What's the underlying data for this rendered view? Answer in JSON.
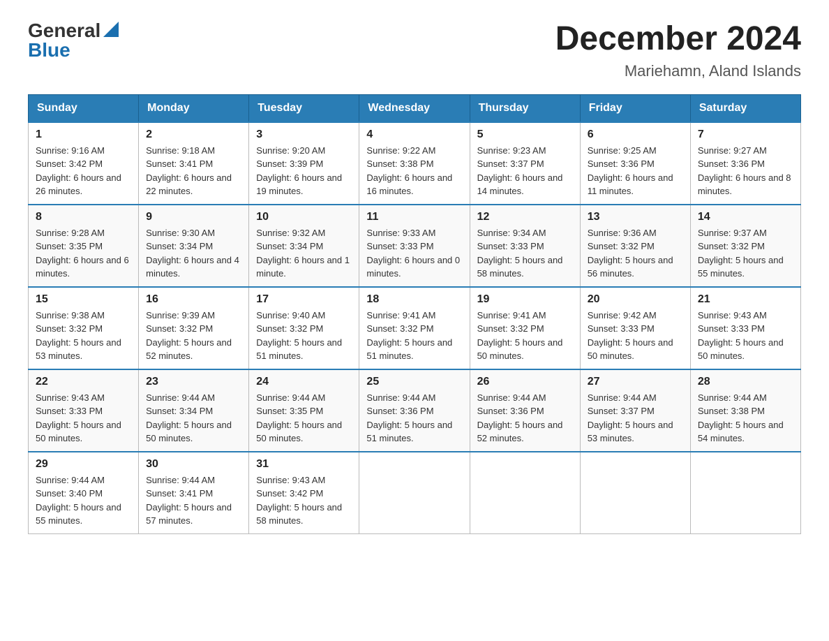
{
  "header": {
    "logo_general": "General",
    "logo_blue": "Blue",
    "title": "December 2024",
    "subtitle": "Mariehamn, Aland Islands"
  },
  "weekdays": [
    "Sunday",
    "Monday",
    "Tuesday",
    "Wednesday",
    "Thursday",
    "Friday",
    "Saturday"
  ],
  "weeks": [
    [
      {
        "day": "1",
        "sunrise": "9:16 AM",
        "sunset": "3:42 PM",
        "daylight": "6 hours and 26 minutes."
      },
      {
        "day": "2",
        "sunrise": "9:18 AM",
        "sunset": "3:41 PM",
        "daylight": "6 hours and 22 minutes."
      },
      {
        "day": "3",
        "sunrise": "9:20 AM",
        "sunset": "3:39 PM",
        "daylight": "6 hours and 19 minutes."
      },
      {
        "day": "4",
        "sunrise": "9:22 AM",
        "sunset": "3:38 PM",
        "daylight": "6 hours and 16 minutes."
      },
      {
        "day": "5",
        "sunrise": "9:23 AM",
        "sunset": "3:37 PM",
        "daylight": "6 hours and 14 minutes."
      },
      {
        "day": "6",
        "sunrise": "9:25 AM",
        "sunset": "3:36 PM",
        "daylight": "6 hours and 11 minutes."
      },
      {
        "day": "7",
        "sunrise": "9:27 AM",
        "sunset": "3:36 PM",
        "daylight": "6 hours and 8 minutes."
      }
    ],
    [
      {
        "day": "8",
        "sunrise": "9:28 AM",
        "sunset": "3:35 PM",
        "daylight": "6 hours and 6 minutes."
      },
      {
        "day": "9",
        "sunrise": "9:30 AM",
        "sunset": "3:34 PM",
        "daylight": "6 hours and 4 minutes."
      },
      {
        "day": "10",
        "sunrise": "9:32 AM",
        "sunset": "3:34 PM",
        "daylight": "6 hours and 1 minute."
      },
      {
        "day": "11",
        "sunrise": "9:33 AM",
        "sunset": "3:33 PM",
        "daylight": "6 hours and 0 minutes."
      },
      {
        "day": "12",
        "sunrise": "9:34 AM",
        "sunset": "3:33 PM",
        "daylight": "5 hours and 58 minutes."
      },
      {
        "day": "13",
        "sunrise": "9:36 AM",
        "sunset": "3:32 PM",
        "daylight": "5 hours and 56 minutes."
      },
      {
        "day": "14",
        "sunrise": "9:37 AM",
        "sunset": "3:32 PM",
        "daylight": "5 hours and 55 minutes."
      }
    ],
    [
      {
        "day": "15",
        "sunrise": "9:38 AM",
        "sunset": "3:32 PM",
        "daylight": "5 hours and 53 minutes."
      },
      {
        "day": "16",
        "sunrise": "9:39 AM",
        "sunset": "3:32 PM",
        "daylight": "5 hours and 52 minutes."
      },
      {
        "day": "17",
        "sunrise": "9:40 AM",
        "sunset": "3:32 PM",
        "daylight": "5 hours and 51 minutes."
      },
      {
        "day": "18",
        "sunrise": "9:41 AM",
        "sunset": "3:32 PM",
        "daylight": "5 hours and 51 minutes."
      },
      {
        "day": "19",
        "sunrise": "9:41 AM",
        "sunset": "3:32 PM",
        "daylight": "5 hours and 50 minutes."
      },
      {
        "day": "20",
        "sunrise": "9:42 AM",
        "sunset": "3:33 PM",
        "daylight": "5 hours and 50 minutes."
      },
      {
        "day": "21",
        "sunrise": "9:43 AM",
        "sunset": "3:33 PM",
        "daylight": "5 hours and 50 minutes."
      }
    ],
    [
      {
        "day": "22",
        "sunrise": "9:43 AM",
        "sunset": "3:33 PM",
        "daylight": "5 hours and 50 minutes."
      },
      {
        "day": "23",
        "sunrise": "9:44 AM",
        "sunset": "3:34 PM",
        "daylight": "5 hours and 50 minutes."
      },
      {
        "day": "24",
        "sunrise": "9:44 AM",
        "sunset": "3:35 PM",
        "daylight": "5 hours and 50 minutes."
      },
      {
        "day": "25",
        "sunrise": "9:44 AM",
        "sunset": "3:36 PM",
        "daylight": "5 hours and 51 minutes."
      },
      {
        "day": "26",
        "sunrise": "9:44 AM",
        "sunset": "3:36 PM",
        "daylight": "5 hours and 52 minutes."
      },
      {
        "day": "27",
        "sunrise": "9:44 AM",
        "sunset": "3:37 PM",
        "daylight": "5 hours and 53 minutes."
      },
      {
        "day": "28",
        "sunrise": "9:44 AM",
        "sunset": "3:38 PM",
        "daylight": "5 hours and 54 minutes."
      }
    ],
    [
      {
        "day": "29",
        "sunrise": "9:44 AM",
        "sunset": "3:40 PM",
        "daylight": "5 hours and 55 minutes."
      },
      {
        "day": "30",
        "sunrise": "9:44 AM",
        "sunset": "3:41 PM",
        "daylight": "5 hours and 57 minutes."
      },
      {
        "day": "31",
        "sunrise": "9:43 AM",
        "sunset": "3:42 PM",
        "daylight": "5 hours and 58 minutes."
      },
      null,
      null,
      null,
      null
    ]
  ],
  "labels": {
    "sunrise": "Sunrise:",
    "sunset": "Sunset:",
    "daylight": "Daylight:"
  }
}
